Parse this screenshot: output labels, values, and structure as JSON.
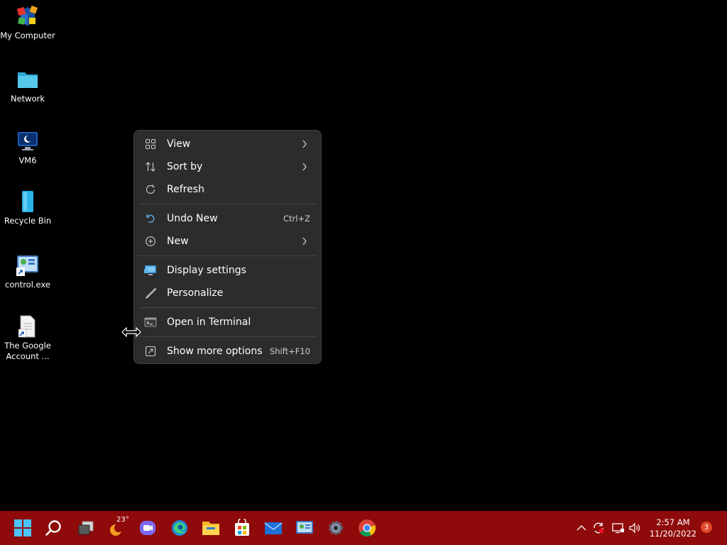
{
  "desktop": {
    "icons": [
      {
        "label": "My Computer",
        "icon": "virtualbox-icon"
      },
      {
        "label": "Network",
        "icon": "network-folder-icon"
      },
      {
        "label": "VM6",
        "icon": "monitor-icon"
      },
      {
        "label": "Recycle Bin",
        "icon": "recycle-bin-icon"
      },
      {
        "label": "control.exe",
        "icon": "control-panel-shortcut-icon"
      },
      {
        "label": "The Google\nAccount ...",
        "icon": "document-shortcut-icon"
      }
    ]
  },
  "context_menu": {
    "items": [
      {
        "label": "View",
        "icon": "view-grid-icon",
        "submenu": true
      },
      {
        "label": "Sort by",
        "icon": "sort-icon",
        "submenu": true
      },
      {
        "label": "Refresh",
        "icon": "refresh-icon"
      },
      {
        "label": "Undo New",
        "icon": "undo-icon",
        "shortcut": "Ctrl+Z"
      },
      {
        "label": "New",
        "icon": "new-plus-icon",
        "submenu": true
      },
      {
        "label": "Display settings",
        "icon": "display-settings-icon"
      },
      {
        "label": "Personalize",
        "icon": "personalize-brush-icon"
      },
      {
        "label": "Open in Terminal",
        "icon": "terminal-icon"
      },
      {
        "label": "Show more options",
        "icon": "more-options-icon",
        "shortcut": "Shift+F10"
      }
    ]
  },
  "taskbar": {
    "apps": [
      "start-icon",
      "search-icon",
      "task-view-icon",
      "weather-icon",
      "teams-chat-icon",
      "edge-icon",
      "file-explorer-icon",
      "store-icon",
      "mail-icon",
      "control-panel-icon",
      "settings-icon",
      "chrome-icon"
    ],
    "weather_temp": "23°",
    "tray": [
      "chevron-up-icon",
      "sync-icon",
      "network-icon",
      "volume-icon"
    ],
    "time": "2:57 AM",
    "date": "11/20/2022",
    "notification_count": "3"
  },
  "colors": {
    "taskbar": "#8f0a0a",
    "menu_bg": "#2c2c2c",
    "desktop_bg": "#000000"
  }
}
